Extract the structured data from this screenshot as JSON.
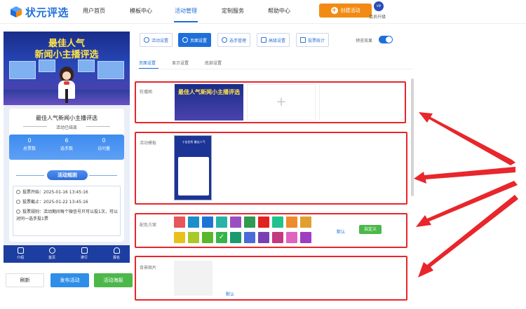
{
  "brand": {
    "logo_text": "状元评选"
  },
  "nav": {
    "items": [
      "用户首页",
      "模板中心",
      "活动管理",
      "定制服务",
      "帮助中心"
    ],
    "active_index": 2,
    "create_button": "创建活动",
    "vip_badge": "VIP",
    "vip_label": "会员升级"
  },
  "preview": {
    "banner_line1": "最佳人气",
    "banner_line2": "新闻小主播评选",
    "title": "最佳人气新闻小主播评选",
    "status": "活动已结束",
    "stats": [
      {
        "value": "0",
        "label": "总票数"
      },
      {
        "value": "6",
        "label": "选手数"
      },
      {
        "value": "0",
        "label": "访问量"
      }
    ],
    "rules_title": "活动规则",
    "rules": [
      "投票开始：2025-01-16 13:45:16",
      "投票截止：2025-01-22 13:45:16",
      "投票规则：活动期间每个微信号只可以投1次，可以对同一选手投1票"
    ],
    "tabs": [
      "介绍",
      "首页",
      "排行",
      "报名"
    ],
    "actions": {
      "refresh": "刷新",
      "publish": "发布活动",
      "poster": "活动海报"
    }
  },
  "toolbar": {
    "buttons": [
      "活动设置",
      "页面设置",
      "选手管理",
      "高级设置",
      "投票统计"
    ],
    "active_index": 1,
    "preview_label": "预览效果",
    "preview_enabled": true
  },
  "subtabs": {
    "items": [
      "页面设置",
      "显示设置",
      "底部设置"
    ],
    "active_index": 0
  },
  "sections": {
    "carousel": {
      "label": "轮播图",
      "image_caption": "最佳人气新闻小主播评选",
      "add_symbol": "+"
    },
    "template": {
      "label": "活动模板",
      "thumb_caption": "十佳优秀 最佳人气"
    },
    "color": {
      "label": "配色方案",
      "row1": [
        "#e6565b",
        "#1a8fc9",
        "#1e74d6",
        "#29b3a8",
        "#9b4ec2",
        "#2e9a52",
        "#e02222",
        "#21c28c",
        "#f08a2e",
        "#e0a030"
      ],
      "row2": [
        "#e8c11c",
        "#a8c928",
        "#56b82a",
        "#37b54a",
        "#1a9b6e",
        "#4a6bd8",
        "#7a3fb5",
        "#c43a80",
        "#e064bf",
        "#9f3dc0"
      ],
      "selected": "#37b54a",
      "default_label": "默认",
      "custom_button": "自定义"
    },
    "background": {
      "label": "背景图片",
      "default_label": "默认"
    }
  },
  "colors": {
    "accent": "#1e6fd9",
    "highlight": "#e8262b",
    "orange": "#f28b15",
    "green": "#4cb84a"
  }
}
